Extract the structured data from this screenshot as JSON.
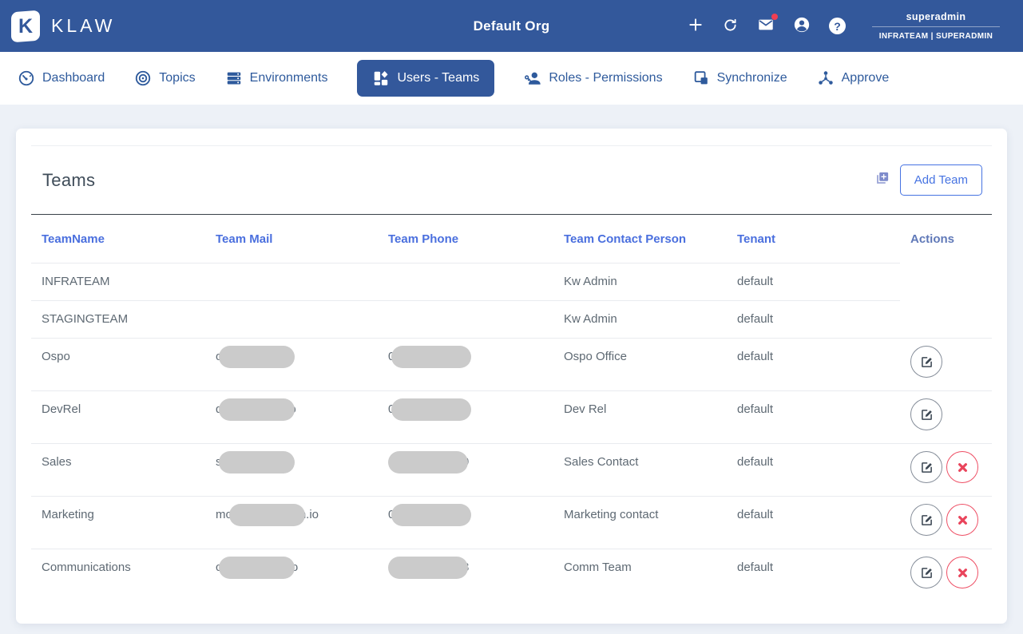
{
  "colors": {
    "header_bg": "#33589B",
    "nav_link": "#2E5A9C",
    "active_tab_bg": "#33589B",
    "table_header_link": "#4A6FDE",
    "actions_header": "#6079B8",
    "body_text": "#5E6973",
    "page_bg": "#EDF1F7",
    "danger": "#E9445B",
    "redaction_pill": "#CBCBCB",
    "accent_blue": "#4673E2"
  },
  "header": {
    "logo_letter": "K",
    "brand": "KLAW",
    "org_title": "Default Org",
    "help_glyph": "?",
    "user_name": "superadmin",
    "user_role_line": "INFRATEAM | SUPERADMIN"
  },
  "nav": {
    "items": [
      {
        "label": "Dashboard",
        "icon": "gauge-icon",
        "active": false
      },
      {
        "label": "Topics",
        "icon": "target-icon",
        "active": false
      },
      {
        "label": "Environments",
        "icon": "server-stack-icon",
        "active": false
      },
      {
        "label": "Users - Teams",
        "icon": "dashboard-grid-icon",
        "active": true
      },
      {
        "label": "Roles - Permissions",
        "icon": "user-key-icon",
        "active": false
      },
      {
        "label": "Synchronize",
        "icon": "layers-icon",
        "active": false
      },
      {
        "label": "Approve",
        "icon": "hub-icon",
        "active": false
      }
    ]
  },
  "page": {
    "section_title": "Teams",
    "add_team_label": "Add Team",
    "table": {
      "columns": [
        "TeamName",
        "Team Mail",
        "Team Phone",
        "Team Contact Person",
        "Tenant",
        "Actions"
      ],
      "rows": [
        {
          "name": "INFRATEAM",
          "mail": null,
          "phone": null,
          "contact": "Kw Admin",
          "tenant": "default",
          "can_edit": false,
          "can_delete": false,
          "compact": true,
          "divider": "partial"
        },
        {
          "name": "STAGINGTEAM",
          "mail": null,
          "phone": null,
          "contact": "Kw Admin",
          "tenant": "default",
          "can_edit": false,
          "can_delete": false,
          "compact": true,
          "divider": "full"
        },
        {
          "name": "Ospo",
          "mail": {
            "visible_prefix": "o",
            "visible_suffix": "",
            "redacted": true
          },
          "phone": {
            "visible_prefix": "0",
            "visible_suffix": "",
            "redacted": true
          },
          "contact": "Ospo Office",
          "tenant": "default",
          "can_edit": true,
          "can_delete": false,
          "compact": false,
          "divider": "full"
        },
        {
          "name": "DevRel",
          "mail": {
            "visible_prefix": "d",
            "visible_suffix": "o",
            "redacted": true
          },
          "phone": {
            "visible_prefix": "0",
            "visible_suffix": "",
            "redacted": true
          },
          "contact": "Dev Rel",
          "tenant": "default",
          "can_edit": true,
          "can_delete": false,
          "compact": false,
          "divider": "full"
        },
        {
          "name": "Sales",
          "mail": {
            "visible_prefix": "s",
            "visible_suffix": "",
            "redacted": true
          },
          "phone": {
            "visible_prefix": "",
            "visible_suffix": "9",
            "redacted": true
          },
          "contact": "Sales Contact",
          "tenant": "default",
          "can_edit": true,
          "can_delete": true,
          "compact": false,
          "divider": "full"
        },
        {
          "name": "Marketing",
          "mail": {
            "visible_prefix": "mo",
            "visible_suffix": "n.io",
            "redacted": true
          },
          "phone": {
            "visible_prefix": "0",
            "visible_suffix": "",
            "redacted": true
          },
          "contact": "Marketing contact",
          "tenant": "default",
          "can_edit": true,
          "can_delete": true,
          "compact": false,
          "divider": "full"
        },
        {
          "name": "Communications",
          "mail": {
            "visible_prefix": "c",
            "visible_suffix": "io",
            "redacted": true
          },
          "phone": {
            "visible_prefix": "",
            "visible_suffix": "3",
            "redacted": true
          },
          "contact": "Comm Team",
          "tenant": "default",
          "can_edit": true,
          "can_delete": true,
          "compact": false,
          "divider": "none"
        }
      ]
    }
  }
}
